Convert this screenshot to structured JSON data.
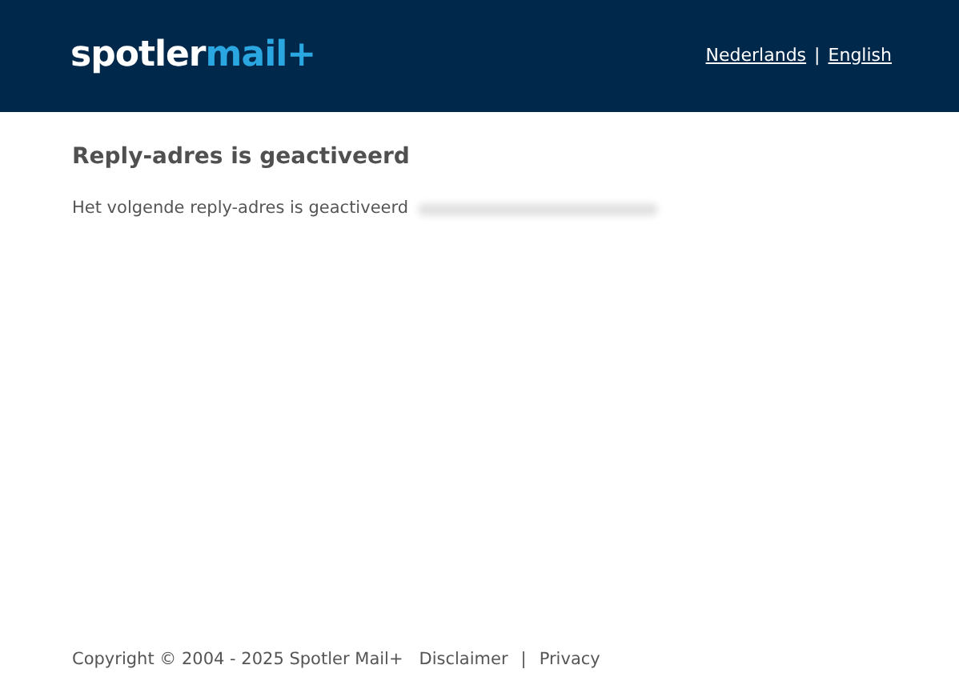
{
  "header": {
    "logo": {
      "part_1": "spotler",
      "part_2": "mail+"
    },
    "languages": [
      {
        "label": "Nederlands"
      },
      {
        "label": "English"
      }
    ],
    "separator": "|"
  },
  "content": {
    "title": "Reply-adres is geactiveerd",
    "message": "Het volgende reply-adres is geactiveerd"
  },
  "footer": {
    "copyright": "Copyright © 2004 - 2025 Spotler Mail+",
    "links": [
      {
        "label": "Disclaimer"
      },
      {
        "label": "Privacy"
      }
    ],
    "separator": "|"
  }
}
